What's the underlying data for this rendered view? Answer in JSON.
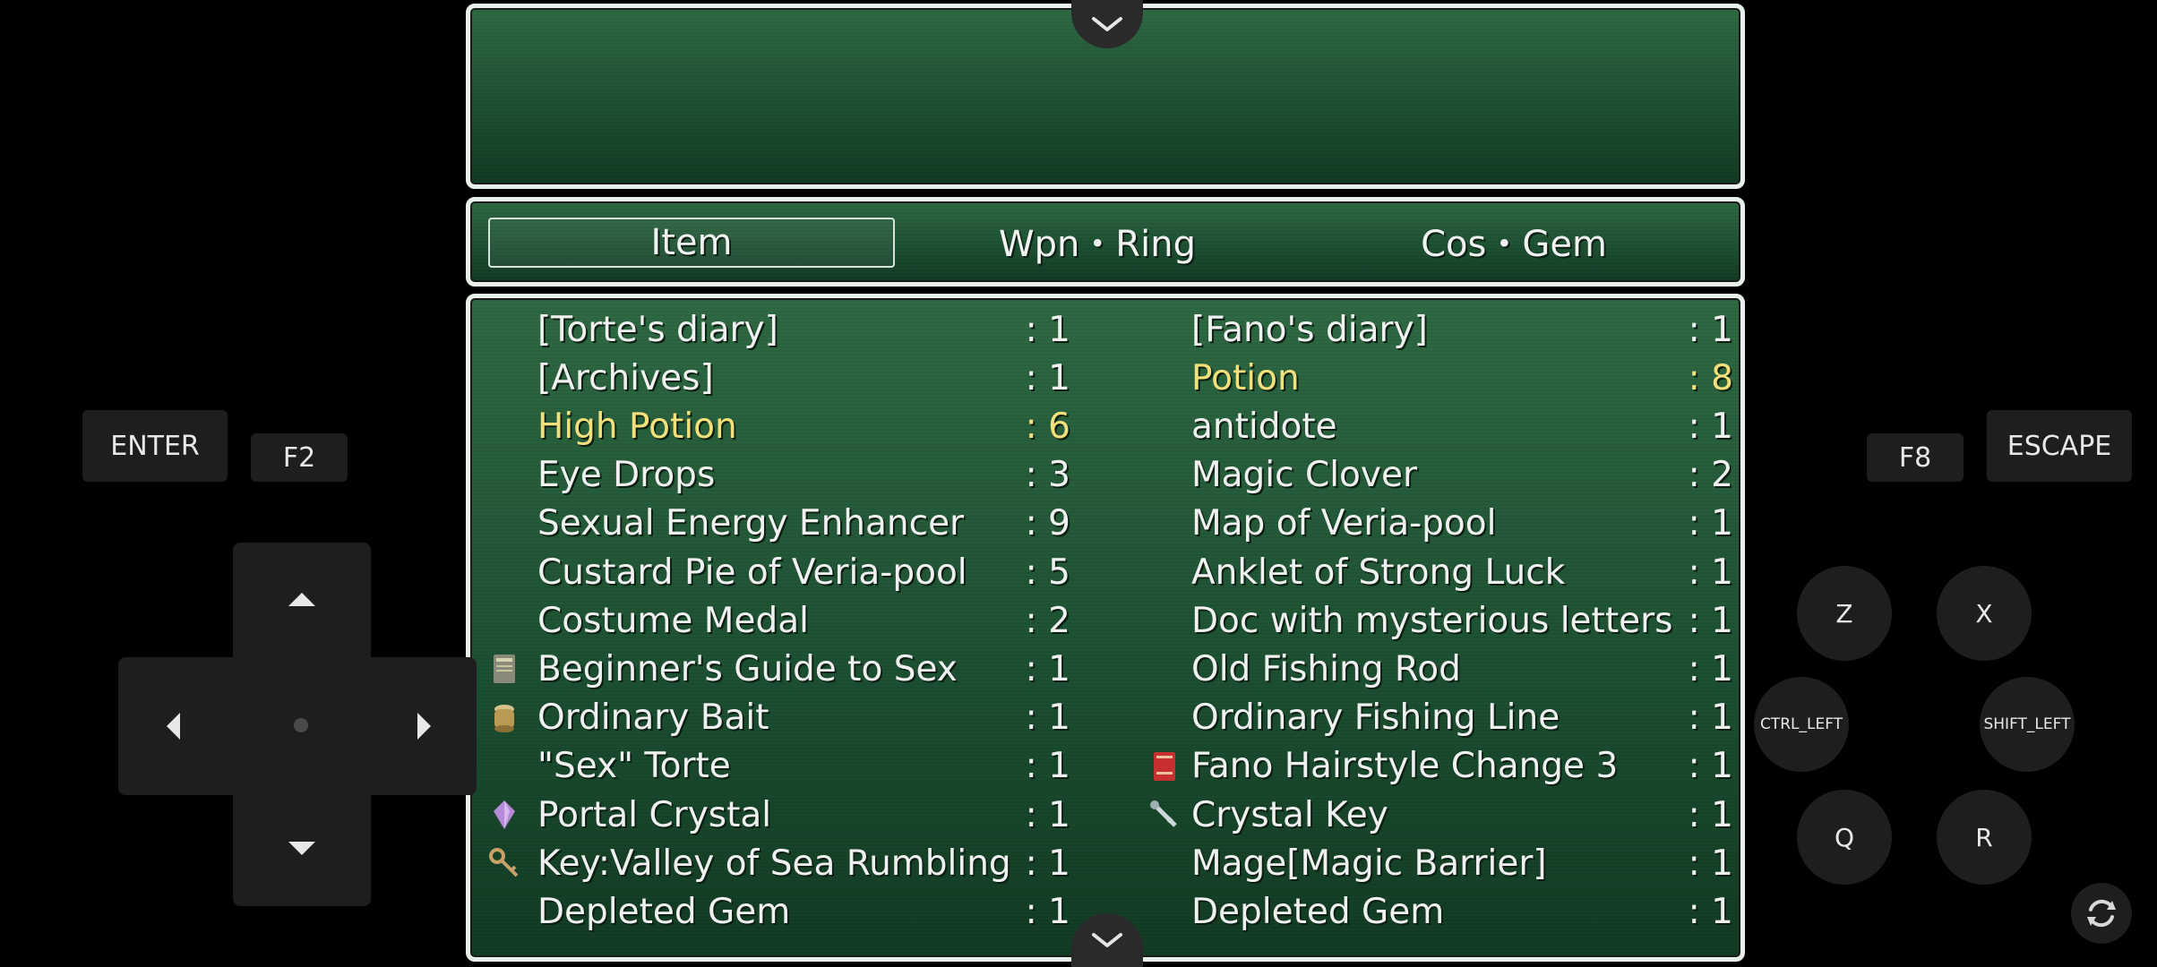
{
  "tabs": {
    "item": "Item",
    "wpn_ring": "Wpn・Ring",
    "cos_gem": "Cos・Gem"
  },
  "left_items": [
    {
      "name": "[Torte's diary]",
      "qty": ": 1",
      "icon": "",
      "highlight": false
    },
    {
      "name": "[Archives]",
      "qty": ": 1",
      "icon": "",
      "highlight": false
    },
    {
      "name": "High Potion",
      "qty": ": 6",
      "icon": "",
      "highlight": true
    },
    {
      "name": "Eye Drops",
      "qty": ": 3",
      "icon": "",
      "highlight": false
    },
    {
      "name": "Sexual Energy Enhancer",
      "qty": ": 9",
      "icon": "",
      "highlight": false
    },
    {
      "name": "Custard Pie of Veria-pool",
      "qty": ": 5",
      "icon": "",
      "highlight": false
    },
    {
      "name": "Costume Medal",
      "qty": ": 2",
      "icon": "",
      "highlight": false
    },
    {
      "name": "Beginner's Guide to Sex",
      "qty": ": 1",
      "icon": "book-icon",
      "highlight": false
    },
    {
      "name": "Ordinary Bait",
      "qty": ": 1",
      "icon": "jar-icon",
      "highlight": false
    },
    {
      "name": "\"Sex\" Torte",
      "qty": ": 1",
      "icon": "",
      "highlight": false
    },
    {
      "name": "Portal Crystal",
      "qty": ": 1",
      "icon": "crystal-icon",
      "highlight": false
    },
    {
      "name": "Key:Valley of Sea Rumbling",
      "qty": ": 1",
      "icon": "key-icon",
      "highlight": false
    },
    {
      "name": "Depleted Gem",
      "qty": ": 1",
      "icon": "",
      "highlight": false
    }
  ],
  "right_items": [
    {
      "name": "[Fano's diary]",
      "qty": ": 1",
      "icon": "",
      "highlight": false
    },
    {
      "name": "Potion",
      "qty": ": 8",
      "icon": "",
      "highlight": true
    },
    {
      "name": "antidote",
      "qty": ": 1",
      "icon": "",
      "highlight": false
    },
    {
      "name": "Magic Clover",
      "qty": ": 2",
      "icon": "",
      "highlight": false
    },
    {
      "name": "Map of Veria-pool",
      "qty": ": 1",
      "icon": "",
      "highlight": false
    },
    {
      "name": "Anklet of Strong Luck",
      "qty": ": 1",
      "icon": "",
      "highlight": false
    },
    {
      "name": "Doc with mysterious letters",
      "qty": ": 1",
      "icon": "",
      "highlight": false
    },
    {
      "name": "Old Fishing Rod",
      "qty": ": 1",
      "icon": "",
      "highlight": false
    },
    {
      "name": "Ordinary Fishing Line",
      "qty": ": 1",
      "icon": "",
      "highlight": false
    },
    {
      "name": "Fano Hairstyle Change 3",
      "qty": ": 1",
      "icon": "red-book-icon",
      "highlight": false
    },
    {
      "name": "Crystal Key",
      "qty": ": 1",
      "icon": "crystal-key-icon",
      "highlight": false
    },
    {
      "name": "Mage[Magic Barrier]",
      "qty": ": 1",
      "icon": "",
      "highlight": false
    },
    {
      "name": "Depleted Gem",
      "qty": ": 1",
      "icon": "",
      "highlight": false
    }
  ],
  "controls": {
    "enter": "ENTER",
    "f2": "F2",
    "f8": "F8",
    "escape": "ESCAPE",
    "z": "Z",
    "x": "X",
    "ctrl_left": "CTRL_LEFT",
    "shift_left": "SHIFT_LEFT",
    "q": "Q",
    "r": "R"
  },
  "colors": {
    "highlight": "#f4e07a",
    "text": "#f0f0f0",
    "window_border": "#e9efe9",
    "window_bg": "#1d5133",
    "button_bg": "#1e1e1e"
  }
}
